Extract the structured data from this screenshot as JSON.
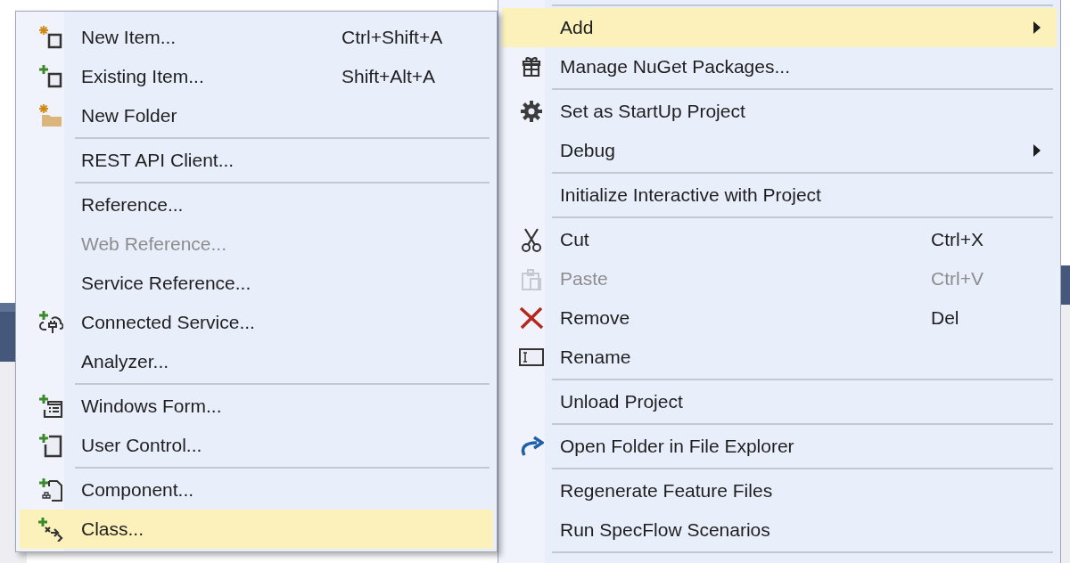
{
  "context_menu": {
    "groups": [
      {
        "items": [
          {
            "label": "Add",
            "submenu": true,
            "selected": true,
            "disabled": false
          },
          {
            "label": "Manage NuGet Packages...",
            "submenu": false,
            "selected": false,
            "disabled": false
          }
        ]
      },
      {
        "items": [
          {
            "label": "Set as StartUp Project",
            "submenu": false,
            "selected": false,
            "disabled": false
          },
          {
            "label": "Debug",
            "submenu": true,
            "selected": false,
            "disabled": false
          }
        ]
      },
      {
        "items": [
          {
            "label": "Initialize Interactive with Project",
            "submenu": false,
            "selected": false,
            "disabled": false
          }
        ]
      },
      {
        "items": [
          {
            "label": "Cut",
            "shortcut": "Ctrl+X",
            "submenu": false,
            "selected": false,
            "disabled": false
          },
          {
            "label": "Paste",
            "shortcut": "Ctrl+V",
            "submenu": false,
            "selected": false,
            "disabled": true
          },
          {
            "label": "Remove",
            "shortcut": "Del",
            "submenu": false,
            "selected": false,
            "disabled": false
          },
          {
            "label": "Rename",
            "submenu": false,
            "selected": false,
            "disabled": false
          }
        ]
      },
      {
        "items": [
          {
            "label": "Unload Project",
            "submenu": false,
            "selected": false,
            "disabled": false
          }
        ]
      },
      {
        "items": [
          {
            "label": "Open Folder in File Explorer",
            "submenu": false,
            "selected": false,
            "disabled": false
          }
        ]
      },
      {
        "items": [
          {
            "label": "Regenerate Feature Files",
            "submenu": false,
            "selected": false,
            "disabled": false
          },
          {
            "label": "Run SpecFlow Scenarios",
            "submenu": false,
            "selected": false,
            "disabled": false
          }
        ]
      }
    ]
  },
  "add_submenu": {
    "groups": [
      {
        "items": [
          {
            "label": "New Item...",
            "shortcut": "Ctrl+Shift+A",
            "selected": false,
            "disabled": false
          },
          {
            "label": "Existing Item...",
            "shortcut": "Shift+Alt+A",
            "selected": false,
            "disabled": false
          },
          {
            "label": "New Folder",
            "selected": false,
            "disabled": false
          }
        ]
      },
      {
        "items": [
          {
            "label": "REST API Client...",
            "selected": false,
            "disabled": false
          }
        ]
      },
      {
        "items": [
          {
            "label": "Reference...",
            "selected": false,
            "disabled": false
          },
          {
            "label": "Web Reference...",
            "selected": false,
            "disabled": true
          },
          {
            "label": "Service Reference...",
            "selected": false,
            "disabled": false
          },
          {
            "label": "Connected Service...",
            "selected": false,
            "disabled": false
          },
          {
            "label": "Analyzer...",
            "selected": false,
            "disabled": false
          }
        ]
      },
      {
        "items": [
          {
            "label": "Windows Form...",
            "selected": false,
            "disabled": false
          },
          {
            "label": "User Control...",
            "selected": false,
            "disabled": false
          }
        ]
      },
      {
        "items": [
          {
            "label": "Component...",
            "selected": false,
            "disabled": false
          },
          {
            "label": "Class...",
            "selected": true,
            "disabled": false
          }
        ]
      }
    ]
  }
}
